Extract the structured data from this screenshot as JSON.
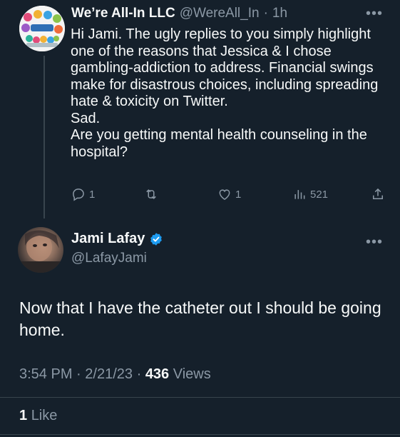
{
  "reply": {
    "display_name": "We’re All-In LLC",
    "handle": "@WereAll_In",
    "separator": "·",
    "time": "1h",
    "body_lines": [
      "Hi Jami. The ugly replies to you simply highlight one of the reasons that Jessica & I chose gambling-addiction to address. Financial swings make for disastrous choices, including spreading hate & toxicity on Twitter.",
      "Sad.",
      "Are you getting mental health counseling in the hospital?"
    ],
    "actions": {
      "reply_count": "1",
      "retweet_count": "",
      "like_count": "1",
      "views_count": "521"
    }
  },
  "tweet": {
    "display_name": "Jami Lafay",
    "handle": "@LafayJami",
    "body": "Now that I have the catheter out I should be going home.",
    "time": "3:54 PM",
    "date_sep": "·",
    "date": "2/21/23",
    "views_sep": "·",
    "views_count": "436",
    "views_label": "Views",
    "likes_count": "1",
    "likes_label": "Like"
  },
  "colors": {
    "background": "#15202b",
    "text": "#f7f9f9",
    "muted": "#8b98a5",
    "verified": "#1d9bf0",
    "divider": "#38444d"
  }
}
